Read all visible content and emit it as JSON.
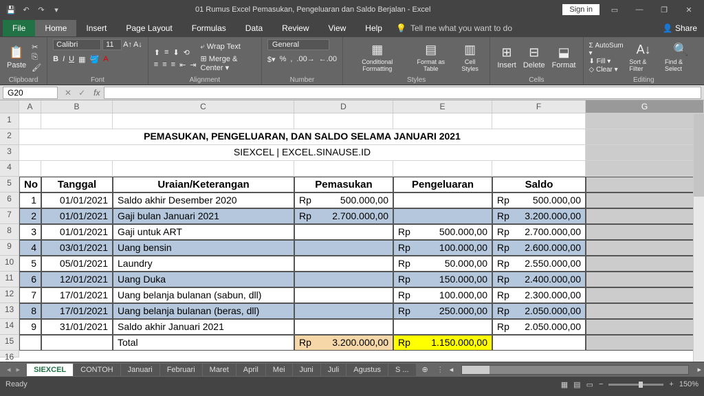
{
  "app": {
    "title": "01 Rumus Excel Pemasukan, Pengeluaran dan Saldo Berjalan  -  Excel",
    "signin": "Sign in",
    "share": "Share"
  },
  "tabs": [
    "File",
    "Home",
    "Insert",
    "Page Layout",
    "Formulas",
    "Data",
    "Review",
    "View",
    "Help"
  ],
  "active_tab": "Home",
  "tellme": "Tell me what you want to do",
  "ribbon": {
    "clipboard": "Clipboard",
    "paste": "Paste",
    "font_group": "Font",
    "font_name": "Calibri",
    "font_size": "11",
    "alignment": "Alignment",
    "wrap": "Wrap Text",
    "merge": "Merge & Center",
    "number": "Number",
    "numfmt": "General",
    "styles": "Styles",
    "cond_fmt": "Conditional Formatting",
    "fmt_table": "Format as Table",
    "cell_styles": "Cell Styles",
    "cells": "Cells",
    "insert": "Insert",
    "delete": "Delete",
    "format": "Format",
    "editing": "Editing",
    "autosum": "AutoSum",
    "fill": "Fill",
    "clear": "Clear",
    "sort": "Sort & Filter",
    "find": "Find & Select"
  },
  "namebox": "G20",
  "columns": [
    "A",
    "B",
    "C",
    "D",
    "E",
    "F",
    "G"
  ],
  "sheet": {
    "title": "PEMASUKAN, PENGELUARAN, DAN SALDO SELAMA JANUARI 2021",
    "subtitle": "SIEXCEL | EXCEL.SINAUSE.ID",
    "headers": {
      "no": "No",
      "tanggal": "Tanggal",
      "uraian": "Uraian/Keterangan",
      "pemasukan": "Pemasukan",
      "pengeluaran": "Pengeluaran",
      "saldo": "Saldo"
    },
    "rows": [
      {
        "no": "1",
        "tgl": "01/01/2021",
        "ur": "Saldo akhir Desember 2020",
        "pm": "500.000,00",
        "pg": "",
        "sd": "500.000,00",
        "hl": ""
      },
      {
        "no": "2",
        "tgl": "01/01/2021",
        "ur": "Gaji bulan Januari 2021",
        "pm": "2.700.000,00",
        "pg": "",
        "sd": "3.200.000,00",
        "hl": "blue"
      },
      {
        "no": "3",
        "tgl": "01/01/2021",
        "ur": "Gaji untuk ART",
        "pm": "",
        "pg": "500.000,00",
        "sd": "2.700.000,00",
        "hl": ""
      },
      {
        "no": "4",
        "tgl": "03/01/2021",
        "ur": "Uang bensin",
        "pm": "",
        "pg": "100.000,00",
        "sd": "2.600.000,00",
        "hl": "blue"
      },
      {
        "no": "5",
        "tgl": "05/01/2021",
        "ur": "Laundry",
        "pm": "",
        "pg": "50.000,00",
        "sd": "2.550.000,00",
        "hl": ""
      },
      {
        "no": "6",
        "tgl": "12/01/2021",
        "ur": "Uang Duka",
        "pm": "",
        "pg": "150.000,00",
        "sd": "2.400.000,00",
        "hl": "blue"
      },
      {
        "no": "7",
        "tgl": "17/01/2021",
        "ur": "Uang belanja bulanan (sabun, dll)",
        "pm": "",
        "pg": "100.000,00",
        "sd": "2.300.000,00",
        "hl": ""
      },
      {
        "no": "8",
        "tgl": "17/01/2021",
        "ur": "Uang belanja bulanan (beras, dll)",
        "pm": "",
        "pg": "250.000,00",
        "sd": "2.050.000,00",
        "hl": "blue"
      },
      {
        "no": "9",
        "tgl": "31/01/2021",
        "ur": "Saldo akhir Januari 2021",
        "pm": "",
        "pg": "",
        "sd": "2.050.000,00",
        "hl": ""
      }
    ],
    "total_label": "Total",
    "total_pm": "3.200.000,00",
    "total_pg": "1.150.000,00",
    "currency": "Rp"
  },
  "sheet_tabs": [
    "SIEXCEL",
    "CONTOH",
    "Januari",
    "Februari",
    "Maret",
    "April",
    "Mei",
    "Juni",
    "Juli",
    "Agustus",
    "S ..."
  ],
  "status": {
    "ready": "Ready",
    "zoom": "150%"
  }
}
